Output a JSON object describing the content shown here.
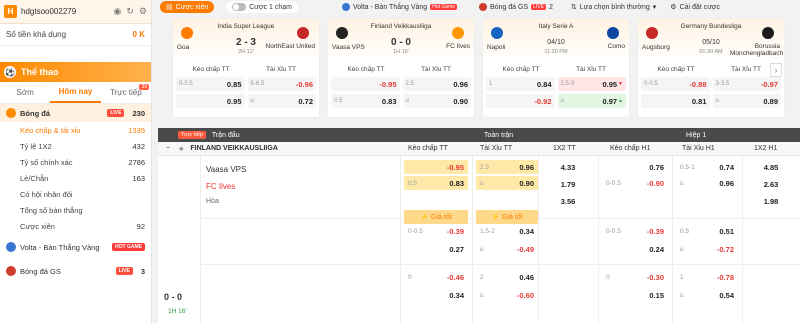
{
  "user": {
    "initial": "H",
    "name": "hdgtsoo002279",
    "balance_label": "Số tiền khả dụng",
    "balance": "0 K"
  },
  "sidebar": {
    "sport_title": "Thể thao",
    "tabs": [
      "Sớm",
      "Hôm nay",
      "Trực tiếp"
    ],
    "tab_badge": "39",
    "sections": [
      {
        "label": "Bóng đá",
        "tag": "LIVE",
        "count": "230"
      },
      {
        "label": "Kèo chấp & tài xỉu",
        "count": "1335"
      },
      {
        "label": "Tỷ lệ 1X2",
        "count": "432"
      },
      {
        "label": "Tỷ số chính xác",
        "count": "2786"
      },
      {
        "label": "Lẻ/Chẵn",
        "count": "163"
      },
      {
        "label": "Có hội nhân đôi",
        "count": ""
      },
      {
        "label": "Tổng số bàn thắng",
        "count": ""
      },
      {
        "label": "Cược xiên",
        "count": "92"
      }
    ],
    "volta": {
      "label": "Volta - Bàn Thắng Vàng",
      "tag": "HOT GAME"
    },
    "gs": {
      "label": "Bóng đá GS",
      "tag": "LIVE",
      "count": "3"
    }
  },
  "topnav": {
    "cuoc_xien": "Cược xiên",
    "cuoc_1_cham": "Cược 1 chạm",
    "volta": "Volta - Bàn Thắng Vàng",
    "volta_tag": "Hot Game",
    "gs": "Bóng đá GS",
    "gs_tag": "LIVE",
    "gs_count": "2",
    "sort": "Lựa chọn bình thường",
    "settings": "Cài đặt cược"
  },
  "cards": [
    {
      "league": "India Super League",
      "home": "Goa",
      "away": "NorthEast United",
      "score": "2 - 3",
      "clock": "2H 12'",
      "h1": "Kèo chấp TT",
      "h2": "Tài Xỉu TT",
      "r1": [
        {
          "h": "0-0.5",
          "o": "0.85",
          "neg": false
        },
        {
          "h": "6-6.5",
          "o": "-0.96",
          "neg": true
        }
      ],
      "r2": [
        {
          "h": "",
          "o": "0.95",
          "neg": false
        },
        {
          "h": "u",
          "o": "0.72",
          "neg": false
        }
      ]
    },
    {
      "league": "Finland Veikkausliiga",
      "home": "Vaasa VPS",
      "away": "FC Ilves",
      "score": "0 - 0",
      "clock": "1H 16'",
      "h1": "Kèo chấp TT",
      "h2": "Tài Xỉu TT",
      "r1": [
        {
          "h": "",
          "o": "-0.95",
          "neg": true
        },
        {
          "h": "2.5",
          "o": "0.96",
          "neg": false
        }
      ],
      "r2": [
        {
          "h": "0.5",
          "o": "0.83",
          "neg": false
        },
        {
          "h": "u",
          "o": "0.90",
          "neg": false
        }
      ]
    },
    {
      "league": "Italy Serie A",
      "home": "Napoli",
      "away": "Como",
      "score": "04/10",
      "clock": "11:30 PM",
      "h1": "Kèo chấp TT",
      "h2": "Tài Xỉu TT",
      "r1": [
        {
          "h": "1",
          "o": "0.84",
          "neg": false
        },
        {
          "h": "2.5-3",
          "o": "0.95",
          "neg": false
        }
      ],
      "r2": [
        {
          "h": "",
          "o": "-0.92",
          "neg": true
        },
        {
          "h": "u",
          "o": "0.97",
          "neg": false
        }
      ]
    },
    {
      "league": "Germany Bundesliga",
      "home": "Augsburg",
      "away": "Borussia Monchengladbach",
      "score": "05/10",
      "clock": "01:30 AM",
      "h1": "Kèo chấp TT",
      "h2": "Tài Xỉu TT",
      "r1": [
        {
          "h": "0-0.5",
          "o": "-0.88",
          "neg": true
        },
        {
          "h": "3-3.5",
          "o": "-0.97",
          "neg": true
        }
      ],
      "r2": [
        {
          "h": "",
          "o": "0.81",
          "neg": false
        },
        {
          "h": "u",
          "o": "0.89",
          "neg": false
        }
      ]
    }
  ],
  "table": {
    "live_label": "Trực tiếp",
    "match_col": "Trận đấu",
    "full_col": "Toàn trận",
    "half_col": "Hiệp 1",
    "league": "FINLAND VEIKKAUSLIIGA",
    "cols": [
      "Kèo chấp TT",
      "Tài Xỉu TT",
      "1X2 TT",
      "Kèo chấp H1",
      "Tài Xỉu H1",
      "1X2 H1"
    ],
    "home": "Vaasa VPS",
    "away": "FC Ilves",
    "draw": "Hòa",
    "score": "0 - 0",
    "clock": "1H 16'",
    "best_price": "Giá tốt",
    "rows": [
      {
        "hdp": [
          {
            "h": "",
            "o": "-0.95"
          },
          {
            "h": "0.5",
            "o": "0.83"
          }
        ],
        "ou": [
          {
            "h": "2.5",
            "o": "0.96"
          },
          {
            "h": "u",
            "o": "0.90"
          }
        ],
        "x12": [
          "4.33",
          "1.79",
          "3.56"
        ],
        "hdp1": [
          {
            "h": "",
            "o": "0.76"
          },
          {
            "h": "0-0.5",
            "o": "-0.90"
          }
        ],
        "ou1": [
          {
            "h": "0.5-1",
            "o": "0.74"
          },
          {
            "h": "u",
            "o": "0.96"
          }
        ],
        "x121": [
          "4.85",
          "2.63",
          "1.98"
        ]
      },
      {
        "hdp": [
          {
            "h": "0-0.5",
            "o": "-0.39"
          },
          {
            "h": "",
            "o": "0.27"
          }
        ],
        "ou": [
          {
            "h": "1.5-2",
            "o": "0.34"
          },
          {
            "h": "u",
            "o": "-0.49"
          }
        ],
        "hdp1": [
          {
            "h": "0-0.5",
            "o": "-0.39"
          },
          {
            "h": "",
            "o": "0.24"
          }
        ],
        "ou1": [
          {
            "h": "0.5",
            "o": "0.51"
          },
          {
            "h": "u",
            "o": "-0.72"
          }
        ]
      },
      {
        "hdp": [
          {
            "h": "0",
            "o": "-0.46"
          },
          {
            "h": "",
            "o": "0.34"
          }
        ],
        "ou": [
          {
            "h": "2",
            "o": "0.46"
          },
          {
            "h": "u",
            "o": "-0.60"
          }
        ],
        "hdp1": [
          {
            "h": "0",
            "o": "-0.30"
          },
          {
            "h": "",
            "o": "0.15"
          }
        ],
        "ou1": [
          {
            "h": "1",
            "o": "-0.78"
          },
          {
            "h": "u",
            "o": "0.54"
          }
        ]
      }
    ]
  }
}
